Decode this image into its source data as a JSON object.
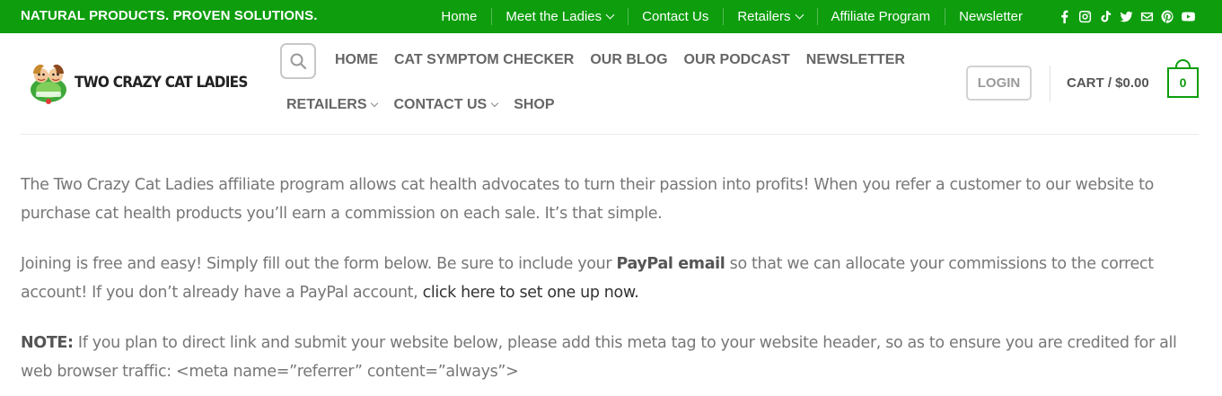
{
  "topbar": {
    "tagline": "NATURAL PRODUCTS. PROVEN SOLUTIONS.",
    "nav": [
      {
        "label": "Home"
      },
      {
        "label": "Meet the Ladies",
        "dropdown": true
      },
      {
        "label": "Contact Us"
      },
      {
        "label": "Retailers",
        "dropdown": true
      },
      {
        "label": "Affiliate Program"
      },
      {
        "label": "Newsletter"
      }
    ],
    "social_icons": [
      "facebook-icon",
      "instagram-icon",
      "tiktok-icon",
      "twitter-icon",
      "email-icon",
      "pinterest-icon",
      "youtube-icon"
    ],
    "color": "#0d9d0d"
  },
  "header": {
    "logo_text": "TWO CRAZY CAT LADIES",
    "nav_row1": [
      "HOME",
      "CAT SYMPTOM CHECKER",
      "OUR BLOG",
      "OUR PODCAST",
      "NEWSLETTER"
    ],
    "nav_row2": [
      {
        "label": "RETAILERS",
        "dropdown": true
      },
      {
        "label": "CONTACT US",
        "dropdown": true
      },
      {
        "label": "SHOP",
        "dropdown": false
      }
    ],
    "login_label": "LOGIN",
    "cart_label": "CART / $0.00",
    "cart_count": "0"
  },
  "content": {
    "p1": "The Two Crazy Cat Ladies affiliate program allows cat health advocates to turn their passion into profits! When you refer a customer to our website to purchase cat health products you’ll earn a commission on each sale. It’s that simple.",
    "p2_a": "Joining is free and easy! Simply fill out the form below. Be sure to include your ",
    "p2_bold": "PayPal email",
    "p2_b": " so that we can allocate your commissions to the correct account! If you don’t already have a PayPal account, ",
    "p2_link": "click here to set one up now.",
    "p3_bold": "NOTE:",
    "p3_text": " If you plan to direct link and submit your website below, please add this meta tag to your website header, so as to ensure you are credited for all web browser traffic: <meta name=”referrer” content=”always”>"
  }
}
